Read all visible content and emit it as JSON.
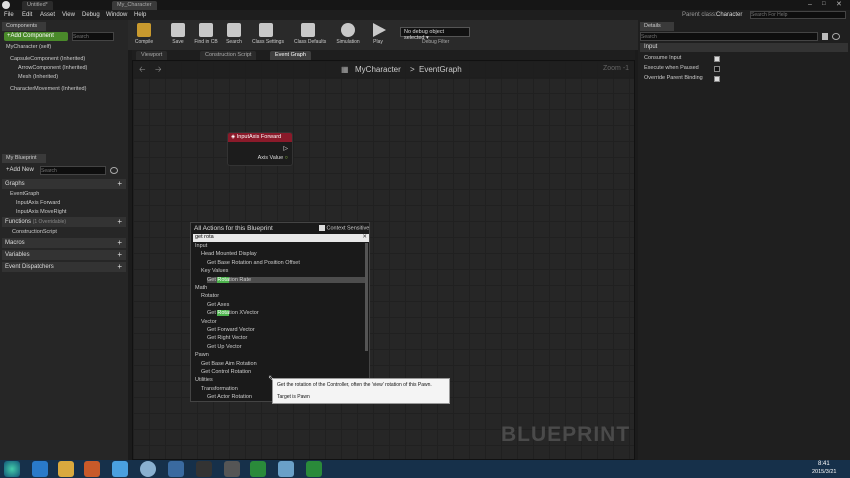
{
  "titlebar": {
    "tabs": [
      "Untitled*",
      "My_Character"
    ]
  },
  "menubar": {
    "items": [
      "File",
      "Edit",
      "Asset",
      "View",
      "Debug",
      "Window",
      "Help"
    ],
    "parent_class_label": "Parent class:",
    "parent_class": "Character",
    "search_placeholder": "Search For Help"
  },
  "components": {
    "tab": "Components",
    "add_label": "+Add Component",
    "search_placeholder": "Search",
    "root": "MyCharacter (self)",
    "items": [
      "CapsuleComponent (Inherited)",
      "ArrowComponent (Inherited)",
      "Mesh (Inherited)",
      "CharacterMovement (Inherited)"
    ]
  },
  "myblueprint": {
    "tab": "My Blueprint",
    "add_label": "+Add New",
    "search_placeholder": "Search",
    "graphs_label": "Graphs",
    "event_graph": "EventGraph",
    "graph_items": [
      "InputAxis Forward",
      "InputAxis MoveRight"
    ],
    "functions_label": "Functions",
    "functions_count": "(1 Overridable)",
    "function_items": [
      "ConstructionScript"
    ],
    "macros_label": "Macros",
    "variables_label": "Variables",
    "dispatchers_label": "Event Dispatchers"
  },
  "toolbar": {
    "buttons": [
      "Compile",
      "Save",
      "Find in CB",
      "Search",
      "Class Settings",
      "Class Defaults",
      "Simulation",
      "Play"
    ],
    "debug_select": "No debug object selected",
    "debug_label": "Debug Filter"
  },
  "editor_tabs": [
    "Viewport",
    "Construction Script",
    "Event Graph"
  ],
  "graph": {
    "breadcrumb_root": "MyCharacter",
    "breadcrumb_sep": ">",
    "breadcrumb_leaf": "EventGraph",
    "zoom": "Zoom -1",
    "watermark": "BLUEPRINT",
    "node": {
      "title": "InputAxis Forward",
      "pin": "Axis Value"
    }
  },
  "context_menu": {
    "title": "All Actions for this Blueprint",
    "context_label": "Context Sensitive",
    "search_value": "get rota",
    "items": [
      {
        "text": "Input",
        "indent": 0
      },
      {
        "text": "Head Mounted Display",
        "indent": 1
      },
      {
        "text": "Get Base Rotation and Position Offset",
        "indent": 2
      },
      {
        "text": "Key Values",
        "indent": 1
      },
      {
        "text": "Get Rotation Rate",
        "indent": 2
      },
      {
        "text": "Math",
        "indent": 0
      },
      {
        "text": "Rotator",
        "indent": 1
      },
      {
        "text": "Get Axes",
        "indent": 2
      },
      {
        "text": "Get Rotation XVector",
        "indent": 2
      },
      {
        "text": "Vector",
        "indent": 1
      },
      {
        "text": "Get Forward Vector",
        "indent": 2
      },
      {
        "text": "Get Right Vector",
        "indent": 2
      },
      {
        "text": "Get Up Vector",
        "indent": 2
      },
      {
        "text": "Pawn",
        "indent": 0
      },
      {
        "text": "Get Base Aim Rotation",
        "indent": 1
      },
      {
        "text": "Get Control Rotation",
        "indent": 1
      },
      {
        "text": "Utilities",
        "indent": 0
      },
      {
        "text": "Transformation",
        "indent": 1
      },
      {
        "text": "Get Actor Rotation",
        "indent": 2
      }
    ],
    "tooltip_line1": "Get the rotation of the Controller, often the 'view' rotation of this Pawn.",
    "tooltip_line2": "Target is Pawn"
  },
  "details": {
    "tab": "Details",
    "search_placeholder": "Search",
    "section": "Input",
    "props": [
      {
        "label": "Consume Input",
        "checked": true
      },
      {
        "label": "Execute when Paused",
        "checked": false
      },
      {
        "label": "Override Parent Binding",
        "checked": true
      }
    ]
  },
  "taskbar": {
    "time": "8:41",
    "date": "2015/3/21"
  }
}
